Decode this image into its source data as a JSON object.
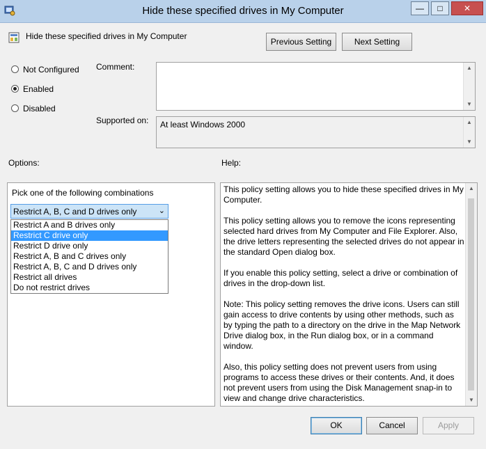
{
  "window": {
    "title": "Hide these specified drives in My Computer",
    "minimize": "—",
    "maximize": "□",
    "close": "✕"
  },
  "header": {
    "policy_name": "Hide these specified drives in My Computer",
    "prev_label": "Previous Setting",
    "next_label": "Next Setting"
  },
  "state": {
    "not_configured": "Not Configured",
    "enabled": "Enabled",
    "disabled": "Disabled",
    "selected": "Enabled"
  },
  "comment": {
    "label": "Comment:",
    "value": ""
  },
  "supported": {
    "label": "Supported on:",
    "value": "At least Windows 2000"
  },
  "options": {
    "label": "Options:",
    "prompt": "Pick one of the following combinations",
    "selected_value": "Restrict A, B, C and D drives only",
    "items": [
      "Restrict A and B drives only",
      "Restrict C drive only",
      "Restrict D drive only",
      "Restrict A, B and C drives only",
      "Restrict A, B, C and D drives only",
      "Restrict all drives",
      "Do not restrict drives"
    ],
    "highlighted": "Restrict C drive only"
  },
  "help": {
    "label": "Help:",
    "paragraphs": [
      "This policy setting allows you to hide these specified drives in My Computer.",
      "This policy setting allows you to remove the icons representing selected hard drives from My Computer and File Explorer. Also, the drive letters representing the selected drives do not appear in the standard Open dialog box.",
      "If you enable this policy setting, select a drive or combination of drives in the drop-down list.",
      "Note: This policy setting removes the drive icons. Users can still gain access to drive contents by using other methods, such as by typing the path to a directory on the drive in the Map Network Drive dialog box, in the Run dialog box, or in a command window.",
      "Also, this policy setting does not prevent users from using programs to access these drives or their contents. And, it does not prevent users from using the Disk Management snap-in to view and change drive characteristics."
    ]
  },
  "footer": {
    "ok": "OK",
    "cancel": "Cancel",
    "apply": "Apply"
  },
  "icons": {
    "window": "policy-window-icon",
    "policy": "policy-setting-icon"
  },
  "colors": {
    "titlebar": "#b9d1ea",
    "selection": "#3399ff",
    "close": "#c75050"
  }
}
